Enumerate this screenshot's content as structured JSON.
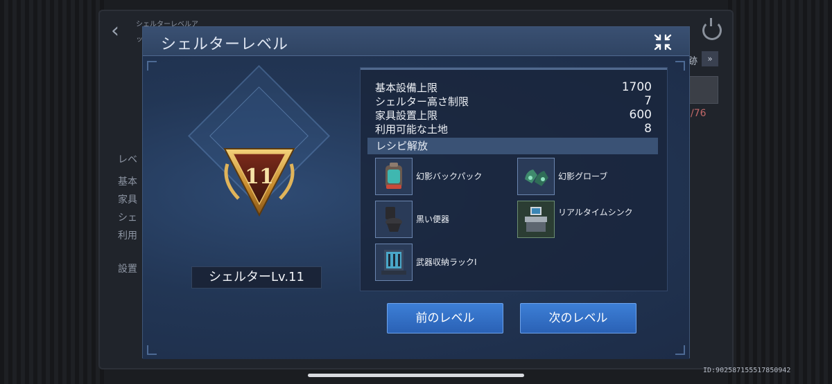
{
  "background": {
    "crumb_line1": "シェルターレベルア",
    "crumb_line2": "ッ",
    "right_label": "跡",
    "right_arrow": "»",
    "count_text": "/76",
    "left_labels": [
      "レベ",
      "基本",
      "家具",
      "シェ",
      "利用",
      "設置"
    ],
    "device_id": "ID:902587155517850942"
  },
  "dialog": {
    "title": "シェルターレベル",
    "level_plate": "シェルターLv.11",
    "badge_number": "11"
  },
  "stats": [
    {
      "label": "基本設備上限",
      "value": "1700"
    },
    {
      "label": "シェルター高さ制限",
      "value": "7"
    },
    {
      "label": "家具設置上限",
      "value": "600"
    },
    {
      "label": "利用可能な土地",
      "value": "8"
    }
  ],
  "recipes": {
    "header": "レシピ解放",
    "items": [
      {
        "label": "幻影バックパック",
        "icon": "backpack-icon"
      },
      {
        "label": "幻影グローブ",
        "icon": "glove-icon"
      },
      {
        "label": "黒い便器",
        "icon": "toilet-icon"
      },
      {
        "label": "リアルタイムシンク",
        "icon": "sink-terminal-icon"
      },
      {
        "label": "武器収納ラックI",
        "icon": "weapon-rack-icon"
      }
    ]
  },
  "buttons": {
    "prev": "前のレベル",
    "next": "次のレベル"
  },
  "colors": {
    "button_blue": "#2f6cc4",
    "panel_bg": "#1f2e49",
    "badge_gold": "#d9a441"
  }
}
